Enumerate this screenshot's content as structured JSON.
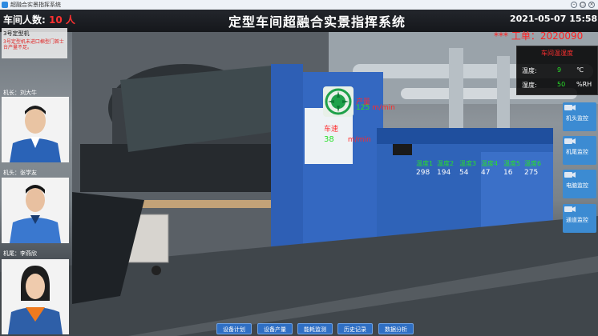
{
  "window": {
    "title": "超融合实景指挥系统"
  },
  "header": {
    "people_count_label": "车间人数:",
    "people_count_value": "10",
    "people_count_unit": "人",
    "title": "定型车间超融合实景指挥系统",
    "datetime": "2021-05-07  15:58:11",
    "work_order_text": "*** 工单：2020090"
  },
  "alarm": {
    "title": "3号定型机",
    "message": "3号定型机未进口棉型门首士台产量不足。"
  },
  "staff": [
    {
      "label": "机长：",
      "name": "刘大牛"
    },
    {
      "label": "机头：",
      "name": "张学友"
    },
    {
      "label": "机尾：",
      "name": "李燕欣"
    }
  ],
  "env_panel": {
    "title": "车间温湿度",
    "temp_label": "温度:",
    "temp_value": "9",
    "temp_unit": "℃",
    "hum_label": "湿度:",
    "hum_value": "50",
    "hum_unit": "%RH"
  },
  "machine": {
    "speed_label": "车速",
    "speed_value": "38",
    "speed_unit": "m/min",
    "output_label": "产量",
    "output_value": "125",
    "output_unit": "m/min"
  },
  "ovens": [
    {
      "label": "温度1",
      "value": "298"
    },
    {
      "label": "温度2",
      "value": "194"
    },
    {
      "label": "温度3",
      "value": "54"
    },
    {
      "label": "温度4",
      "value": "47"
    },
    {
      "label": "温度5",
      "value": "16"
    },
    {
      "label": "温度6",
      "value": "275"
    }
  ],
  "monitors": [
    {
      "label": "机头监控"
    },
    {
      "label": "机尾监控"
    },
    {
      "label": "电脑监控"
    },
    {
      "label": "通道监控"
    }
  ],
  "nav": [
    {
      "label": "设备计划"
    },
    {
      "label": "设备产量"
    },
    {
      "label": "能耗监测"
    },
    {
      "label": "历史记录"
    },
    {
      "label": "数据分析"
    }
  ],
  "colors": {
    "accent_red": "#ff2222",
    "value_green": "#28e028",
    "button_blue": "#3c8bd2"
  }
}
